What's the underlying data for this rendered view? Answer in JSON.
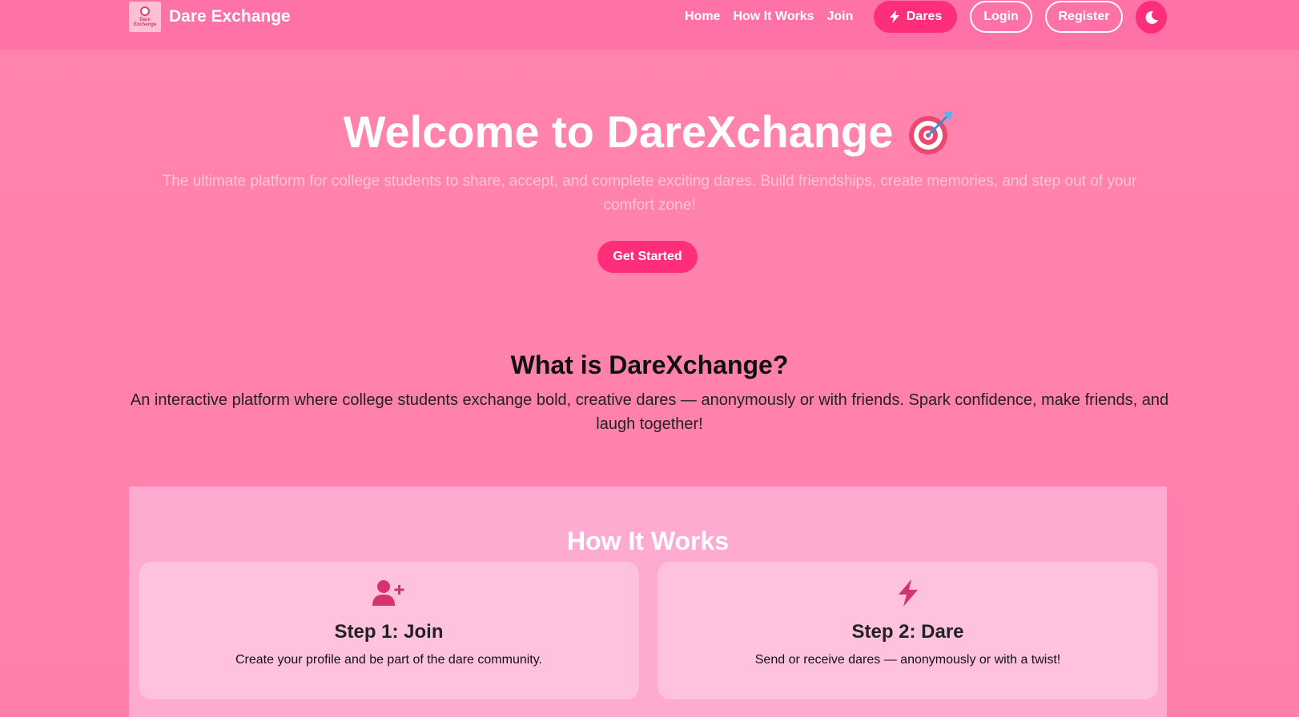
{
  "navbar": {
    "brand_name": "Dare Exchange",
    "brand_logo_text": [
      "Dare",
      "Exchange"
    ],
    "links": [
      "Home",
      "How It Works",
      "Join"
    ],
    "dares_label": "Dares",
    "login_label": "Login",
    "register_label": "Register",
    "theme_icon": "moon-icon"
  },
  "hero": {
    "title": "Welcome to DareXchange",
    "title_emoji": "target-icon",
    "subtitle": "The ultimate platform for college students to share, accept, and complete exciting dares. Build friendships, create memories, and step out of your comfort zone!",
    "cta_label": "Get Started"
  },
  "about": {
    "title": "What is DareXchange?",
    "text": "An interactive platform where college students exchange bold, creative dares — anonymously or with friends. Spark confidence, make friends, and laugh together!"
  },
  "how": {
    "title": "How It Works",
    "steps": [
      {
        "icon": "user-plus-icon",
        "title": "Step 1: Join",
        "text": "Create your profile and be part of the dare community."
      },
      {
        "icon": "bolt-icon",
        "title": "Step 2: Dare",
        "text": "Send or receive dares — anonymously or with a twist!"
      }
    ]
  },
  "colors": {
    "accent": "#ff2e7a",
    "navbar": "#ff72a8",
    "background": "#ff84ad",
    "section": "#ffaad0",
    "card": "#ffc2de",
    "icon": "#d6336c"
  }
}
